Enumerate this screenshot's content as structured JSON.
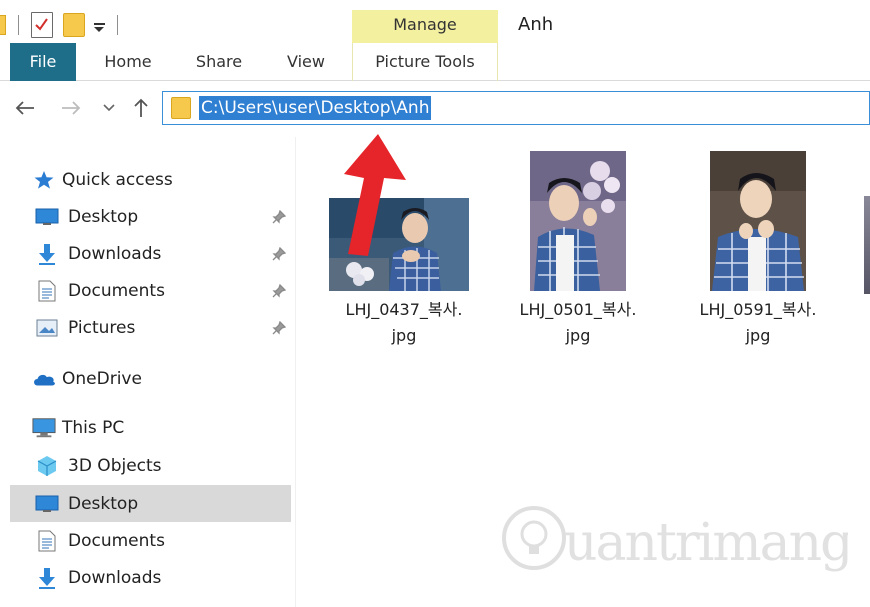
{
  "window": {
    "title": "Anh",
    "context_tab_group": "Manage"
  },
  "ribbon": {
    "tabs": [
      {
        "label": "File"
      },
      {
        "label": "Home"
      },
      {
        "label": "Share"
      },
      {
        "label": "View"
      },
      {
        "label": "Picture Tools"
      }
    ]
  },
  "address_bar": {
    "path": "C:\\Users\\user\\Desktop\\Anh"
  },
  "nav_pane": {
    "quick_access": "Quick access",
    "quick_items": [
      {
        "label": "Desktop",
        "icon": "desktop-icon"
      },
      {
        "label": "Downloads",
        "icon": "downloads-icon"
      },
      {
        "label": "Documents",
        "icon": "documents-icon"
      },
      {
        "label": "Pictures",
        "icon": "pictures-icon"
      }
    ],
    "onedrive": "OneDrive",
    "this_pc": "This PC",
    "pc_items": [
      {
        "label": "3D Objects",
        "icon": "3d-objects-icon"
      },
      {
        "label": "Desktop",
        "icon": "desktop-icon",
        "selected": true
      },
      {
        "label": "Documents",
        "icon": "documents-icon"
      },
      {
        "label": "Downloads",
        "icon": "downloads-icon"
      }
    ]
  },
  "files": [
    {
      "name_line1": "LHJ_0437_복사.",
      "name_line2": "jpg"
    },
    {
      "name_line1": "LHJ_0501_복사.",
      "name_line2": "jpg"
    },
    {
      "name_line1": "LHJ_0591_복사.",
      "name_line2": "jpg"
    }
  ],
  "colors": {
    "file_tab": "#1e6e8a",
    "manage_tab": "#f3f0a0",
    "selection": "#2f7fd2",
    "annotation_arrow": "#e5252a"
  }
}
